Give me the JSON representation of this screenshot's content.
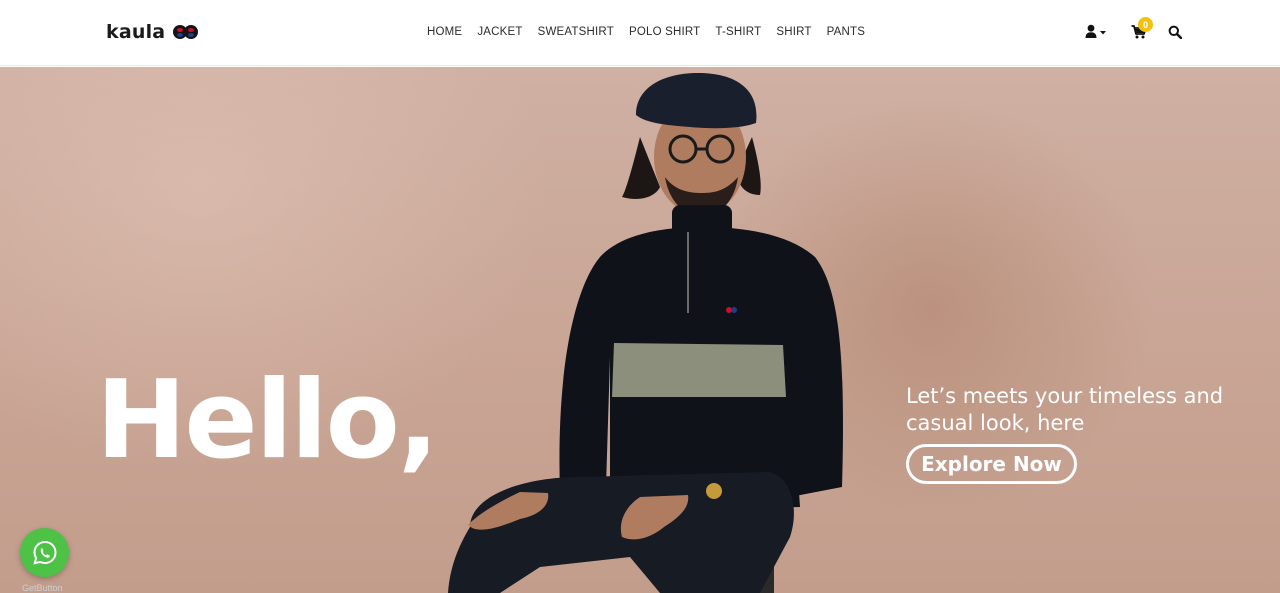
{
  "brand": {
    "name": "kaula"
  },
  "nav": {
    "items": [
      {
        "label": "HOME"
      },
      {
        "label": "JACKET"
      },
      {
        "label": "SWEATSHIRT"
      },
      {
        "label": "POLO SHIRT"
      },
      {
        "label": "T-SHIRT"
      },
      {
        "label": "SHIRT"
      },
      {
        "label": "PANTS"
      }
    ]
  },
  "tools": {
    "user_icon": "user-icon",
    "cart_icon": "cart-icon",
    "cart_count": "0",
    "search_icon": "search-icon"
  },
  "hero": {
    "headline": "Hello,",
    "tagline": "Let’s meets your timeless and casual look, here",
    "cta_label": "Explore Now"
  },
  "whatsapp": {
    "icon": "whatsapp-icon",
    "label": "GetButton"
  },
  "colors": {
    "accent_badge": "#f4c20d",
    "whatsapp_green": "#4dc247",
    "hero_bg": "#c9a595"
  }
}
